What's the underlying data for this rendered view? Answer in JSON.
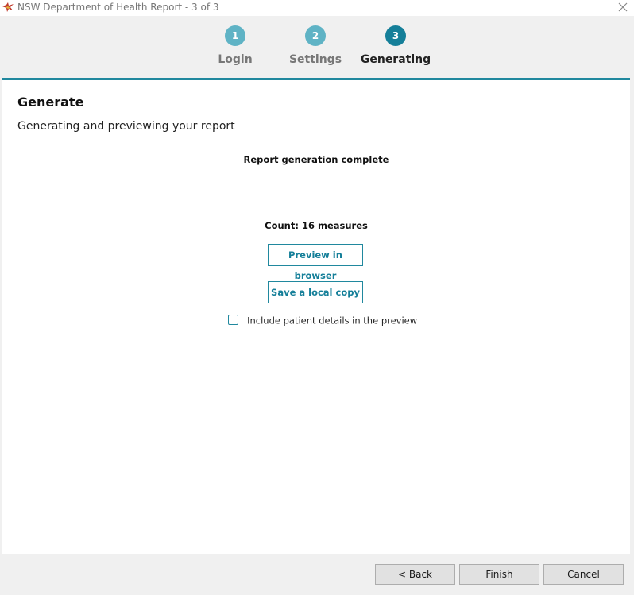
{
  "window": {
    "title": "NSW Department of Health Report - 3 of 3",
    "app_icon": "waratah-logo-icon",
    "close_icon": "close-icon"
  },
  "stepper": {
    "steps": [
      {
        "number": "1",
        "label": "Login",
        "state": "done"
      },
      {
        "number": "2",
        "label": "Settings",
        "state": "done"
      },
      {
        "number": "3",
        "label": "Generating",
        "state": "active"
      }
    ]
  },
  "panel": {
    "heading": "Generate",
    "subheading": "Generating and previewing your report",
    "status": "Report generation complete",
    "count": "Count: 16 measures",
    "preview_button": "Preview in browser",
    "save_button": "Save a local copy",
    "include_patient_details": {
      "label": "Include patient details in the preview",
      "checked": false
    }
  },
  "footer": {
    "back": "< Back",
    "finish": "Finish",
    "cancel": "Cancel"
  },
  "colors": {
    "accent": "#157f99",
    "accent_light": "#5fb3c5",
    "divider": "#20889e"
  }
}
